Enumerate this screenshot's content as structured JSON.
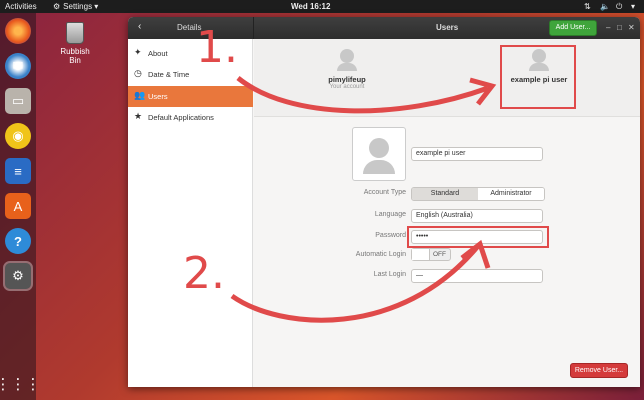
{
  "topbar": {
    "activities": "Activities",
    "app_menu": "Settings ▾",
    "clock": "Wed 16:12"
  },
  "desktop": {
    "trash_label": "Rubbish Bin"
  },
  "window": {
    "left_title": "Details",
    "main_title": "Users",
    "add_user_label": "Add User...",
    "remove_user_label": "Remove User..."
  },
  "sidebar": {
    "items": [
      {
        "label": "About",
        "icon": "star-icon"
      },
      {
        "label": "Date & Time",
        "icon": "clock-icon"
      },
      {
        "label": "Users",
        "icon": "users-icon",
        "active": true
      },
      {
        "label": "Default Applications",
        "icon": "star-icon"
      }
    ]
  },
  "users": {
    "cards": [
      {
        "name": "pimylifeup",
        "sub": "Your account"
      },
      {
        "name": "example pi user",
        "sub": ""
      }
    ]
  },
  "form": {
    "name_value": "example pi user",
    "account_type_label": "Account Type",
    "account_type_options": [
      "Standard",
      "Administrator"
    ],
    "account_type_selected": "Standard",
    "language_label": "Language",
    "language_value": "English (Australia)",
    "password_label": "Password",
    "password_value": "•••••",
    "auto_login_label": "Automatic Login",
    "auto_login_state": "OFF",
    "last_login_label": "Last Login",
    "last_login_value": "—"
  },
  "annotations": {
    "step1": "1.",
    "step2": "2.",
    "color": "#e04a4a"
  },
  "colors": {
    "accent": "#e9773c",
    "add_button": "#3fa53b",
    "remove_button": "#d43b3b"
  }
}
